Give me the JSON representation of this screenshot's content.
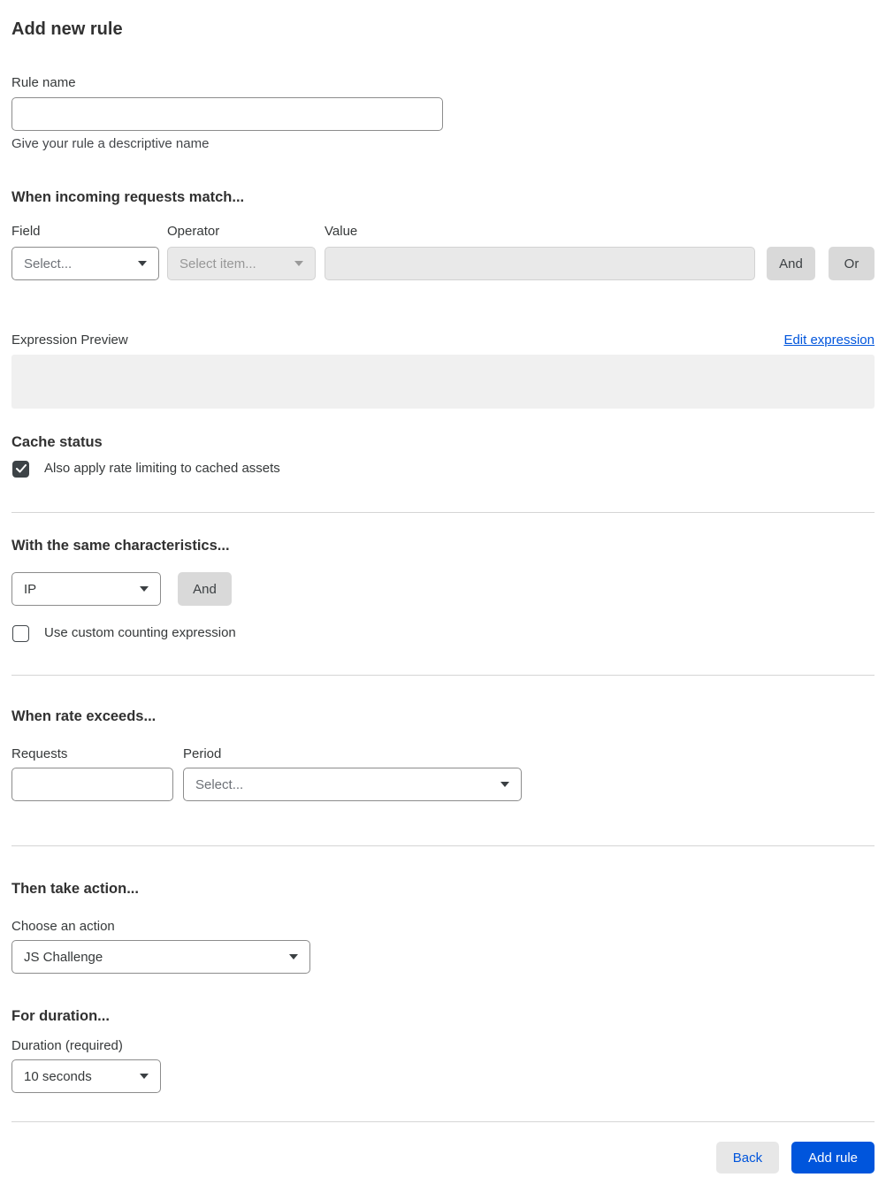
{
  "page": {
    "title": "Add new rule"
  },
  "rule_name": {
    "label": "Rule name",
    "value": "",
    "helper": "Give your rule a descriptive name"
  },
  "match_section": {
    "heading": "When incoming requests match...",
    "field": {
      "label": "Field",
      "selected": "Select..."
    },
    "operator": {
      "label": "Operator",
      "selected": "Select item...",
      "disabled": true
    },
    "value": {
      "label": "Value",
      "value": "",
      "disabled": true
    },
    "and_button": "And",
    "or_button": "Or"
  },
  "expression_preview": {
    "label": "Expression Preview",
    "edit_link": "Edit expression",
    "content": ""
  },
  "cache_status": {
    "heading": "Cache status",
    "checkbox_label": "Also apply rate limiting to cached assets",
    "checked": true
  },
  "characteristics": {
    "heading": "With the same characteristics...",
    "select_value": "IP",
    "and_button": "And",
    "checkbox_label": "Use custom counting expression",
    "checked": false
  },
  "rate_section": {
    "heading": "When rate exceeds...",
    "requests": {
      "label": "Requests",
      "value": ""
    },
    "period": {
      "label": "Period",
      "selected": "Select..."
    }
  },
  "action_section": {
    "heading": "Then take action...",
    "label": "Choose an action",
    "selected": "JS Challenge"
  },
  "duration_section": {
    "heading": "For duration...",
    "label": "Duration (required)",
    "selected": "10 seconds"
  },
  "footer": {
    "back_button": "Back",
    "add_rule_button": "Add rule"
  },
  "colors": {
    "accent_blue": "#0055dc",
    "text": "#36393a",
    "heading": "#313131",
    "disabled_bg": "#e9e9e9",
    "gray_button_bg": "#d9d9d9",
    "preview_bg": "#f0f0f0",
    "divider": "#d5d5d5",
    "checkbox_checked": "#3d4347"
  }
}
